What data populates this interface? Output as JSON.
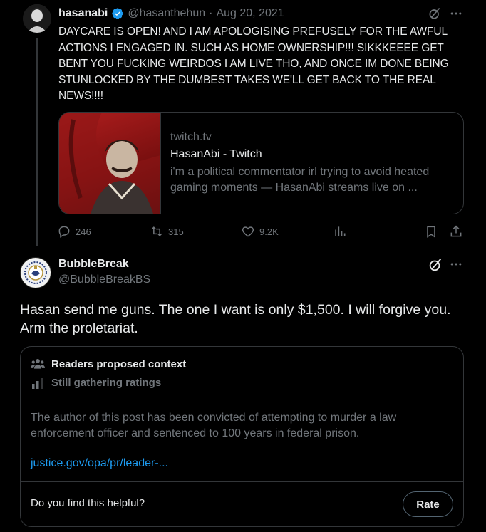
{
  "parent": {
    "name": "hasanabi",
    "handle": "@hasanthehun",
    "separator": "·",
    "date": "Aug 20, 2021",
    "text": "DAYCARE IS OPEN! AND I AM APOLOGISING PREFUSELY FOR THE AWFUL ACTIONS I ENGAGED IN. SUCH AS HOME OWNERSHIP!!! SIKKKEEEE GET BENT YOU FUCKING WEIRDOS I AM LIVE THO, AND ONCE IM DONE BEING STUNLOCKED BY THE DUMBEST TAKES WE'LL GET BACK TO THE REAL NEWS!!!!",
    "card": {
      "domain": "twitch.tv",
      "title": "HasanAbi - Twitch",
      "description": "i'm a political commentator irl trying to avoid heated gaming moments — HasanAbi streams live on ..."
    },
    "stats": {
      "replies": "246",
      "reposts": "315",
      "likes": "9.2K"
    }
  },
  "reply": {
    "name": "BubbleBreak",
    "handle": "@BubbleBreakBS",
    "text": "Hasan send me guns. The one I want is only $1,500. I will forgive you. Arm the proletariat."
  },
  "note": {
    "header": "Readers proposed context",
    "status": "Still gathering ratings",
    "body": "The author of this post has been convicted of attempting to murder a law enforcement officer and sentenced to 100 years in federal prison.",
    "link": "justice.gov/opa/pr/leader-...",
    "question": "Do you find this helpful?",
    "rate_label": "Rate"
  },
  "colors": {
    "background": "#000000",
    "text": "#e7e9ea",
    "muted": "#71767b",
    "link": "#1d9bf0",
    "verified": "#1d9bf0",
    "border": "#333639"
  },
  "icons": [
    "grok-icon",
    "more-icon",
    "reply-icon",
    "repost-icon",
    "like-icon",
    "views-icon",
    "bookmark-icon",
    "share-icon",
    "people-icon",
    "bar-chart-icon",
    "verified-badge-icon"
  ]
}
